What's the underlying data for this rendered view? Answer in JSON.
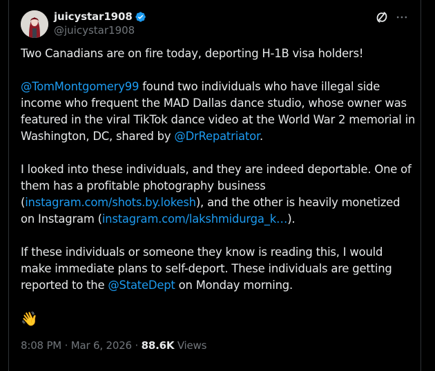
{
  "author": {
    "display_name": "juicystar1908",
    "handle": "@juicystar1908",
    "verified": true,
    "verified_color": "#1d9bf0"
  },
  "post": {
    "p1": "Two Canadians are on fire today, deporting H-1B visa holders!",
    "p2_mention": "@TomMontgomery99",
    "p2_text1": " found two individuals who have illegal side income who frequent the MAD Dallas dance studio, whose owner was featured in the viral TikTok dance video at the World War 2 memorial in Washington, DC, shared by ",
    "p2_mention2": "@DrRepatriator",
    "p2_text2": ".",
    "p3_text1": "I looked into these individuals, and they are indeed deportable. One of them has a profitable photography business (",
    "p3_link1": "instagram.com/shots.by.lokesh",
    "p3_text2": "), and the other is heavily monetized on Instagram (",
    "p3_link2": "instagram.com/lakshmidurga_k…",
    "p3_text3": ").",
    "p4_text1": "If these individuals or someone they know is reading this, I would make immediate plans to self-deport. These individuals are getting reported to the ",
    "p4_mention": "@StateDept",
    "p4_text2": " on Monday morning.",
    "emoji": "👋"
  },
  "meta": {
    "time": "8:08 PM",
    "sep1": " · ",
    "date": "Mar 6, 2026",
    "sep2": " · ",
    "views_count": "88.6K",
    "views_label": " Views"
  },
  "colors": {
    "background": "#000000",
    "text": "#e7e9ea",
    "secondary": "#71767b",
    "link": "#1d9bf0",
    "border": "#2f3336"
  },
  "icons": {
    "grok": "grok-icon",
    "more": "more-icon",
    "verified": "verified-badge-icon"
  }
}
